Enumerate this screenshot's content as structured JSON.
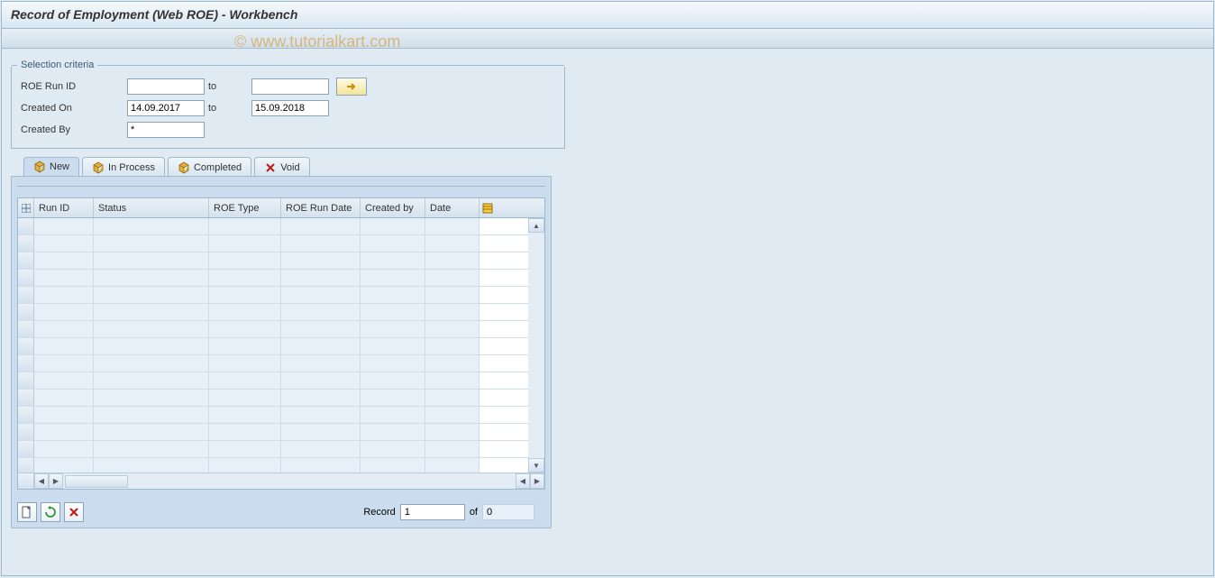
{
  "title": "Record of Employment (Web ROE) - Workbench",
  "watermark": "© www.tutorialkart.com",
  "selection": {
    "group_label": "Selection criteria",
    "roe_run_id": {
      "label": "ROE Run ID",
      "from": "",
      "to_label": "to",
      "to": ""
    },
    "created_on": {
      "label": "Created On",
      "from": "14.09.2017",
      "to_label": "to",
      "to": "15.09.2018"
    },
    "created_by": {
      "label": "Created By",
      "value": "*"
    },
    "multiple_icon": "arrow-right-icon"
  },
  "tabs": {
    "new": "New",
    "in_process": "In Process",
    "completed": "Completed",
    "void": "Void",
    "active": "new"
  },
  "table": {
    "columns": {
      "run_id": "Run ID",
      "status": "Status",
      "roe_type": "ROE Type",
      "roe_run_date": "ROE Run Date",
      "created_by": "Created by",
      "date": "Date"
    },
    "rows": 15
  },
  "footer": {
    "create_icon": "create-icon",
    "refresh_icon": "refresh-icon",
    "delete_icon": "delete-icon",
    "record_label": "Record",
    "record_value": "1",
    "of_label": "of",
    "total_value": "0"
  }
}
